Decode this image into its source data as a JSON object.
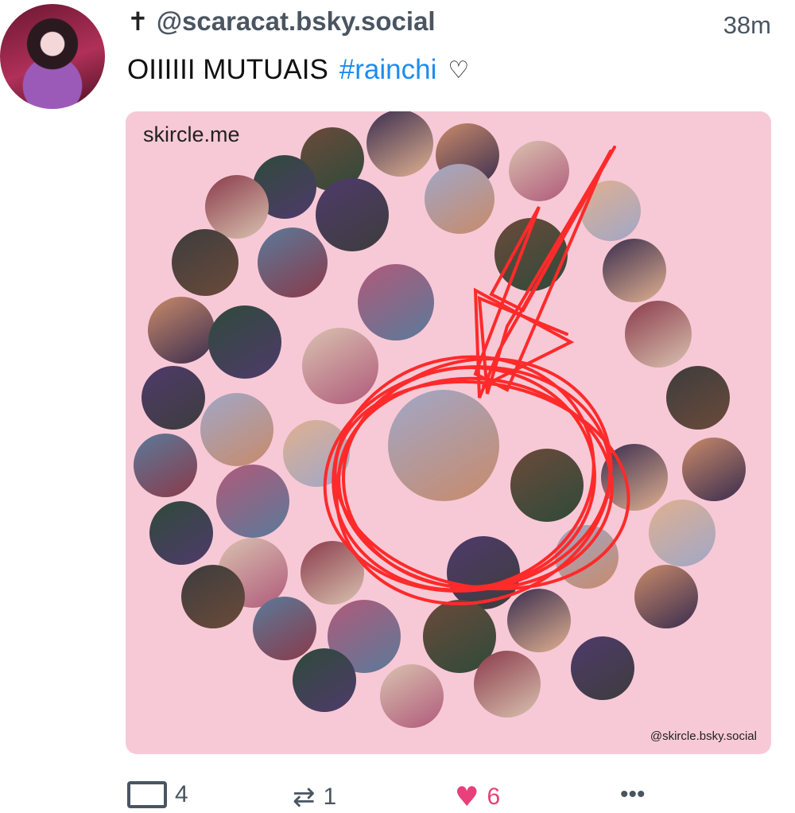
{
  "post": {
    "cross_icon": "✝",
    "handle": "@scaracat.bsky.social",
    "time": "38m",
    "text": "OIIIIII  MUTUAIS",
    "hashtag": "#rainchi",
    "heart_glyph": "♡"
  },
  "image": {
    "site": "skircle.me",
    "credit": "@skircle.bsky.social"
  },
  "actions": {
    "reply_count": "4",
    "repost_count": "1",
    "like_count": "6",
    "more": "•••"
  },
  "colors": {
    "card_bg": "#f7c9d6",
    "hashtag": "#1d8cf0",
    "scribble": "#ff2a2a",
    "like": "#e8407a"
  }
}
